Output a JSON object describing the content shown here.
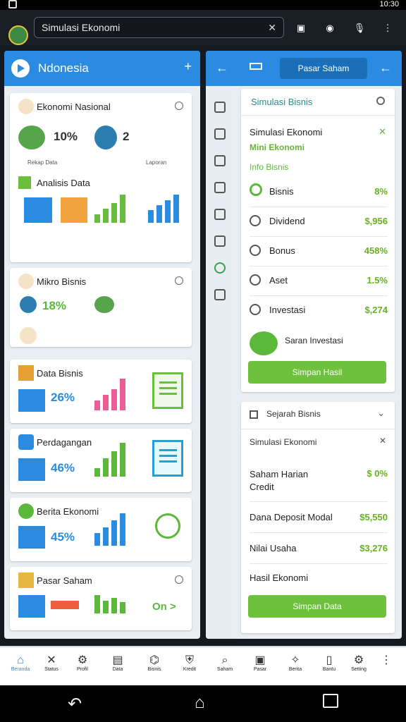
{
  "status": {
    "time": "10:30"
  },
  "address_bar": {
    "value": "Simulasi Ekonomi",
    "clear_icon": "✕"
  },
  "left": {
    "title": "Ndonesia",
    "cards": [
      {
        "title": "Ekonomi Nasional",
        "pct1": "10%",
        "pct2": "2",
        "sub": "Rekap Data",
        "sub2": "Laporan",
        "section": "Analisis Data"
      },
      {
        "title": "Mikro Bisnis",
        "pct": "18%"
      },
      {
        "title": "Data Bisnis",
        "pct": "26%"
      },
      {
        "title": "Perdagangan",
        "pct": "46%"
      },
      {
        "title": "Berita Ekonomi",
        "pct": "45%"
      },
      {
        "title": "Pasar Saham",
        "tag": "On >"
      }
    ]
  },
  "right": {
    "header_pill": "Pasar Saham",
    "top_box_title": "Simulasi Bisnis",
    "sim_title": "Simulasi Ekonomi",
    "sim_subtitle": "Mini Ekonomi",
    "sim_section": "Info Bisnis",
    "sim_rows": [
      {
        "label": "Bisnis",
        "value": "8%"
      },
      {
        "label": "Dividend",
        "value": "$,956"
      },
      {
        "label": "Bonus",
        "value": "458%"
      },
      {
        "label": "Aset",
        "value": "1.5%"
      },
      {
        "label": "Investasi",
        "value": "$,274"
      }
    ],
    "sim_footer": "Saran Investasi",
    "sim_button": "Simpan Hasil",
    "bottom_box_title": "Sejarah Bisnis",
    "bottom_sub": "Simulasi Ekonomi",
    "bottom_rows": [
      {
        "label": "Saham Harian\nCredit",
        "value": "$ 0%"
      },
      {
        "label": "Dana Deposit Modal",
        "value": "$5,550"
      },
      {
        "label": "Nilai Usaha",
        "value": "$3,276"
      },
      {
        "label": "Hasil Ekonomi",
        "value": ""
      }
    ],
    "bottom_button": "Simpan Data"
  },
  "bottom_nav": {
    "items": [
      "Beranda",
      "Status",
      "Profil",
      "Data",
      "Bisnis",
      "Kredit",
      "Saham",
      "Pasar",
      "Berita",
      "Bantu",
      "Setting"
    ]
  },
  "colors": {
    "blue": "#2a8be0",
    "green": "#6cbf3d"
  }
}
